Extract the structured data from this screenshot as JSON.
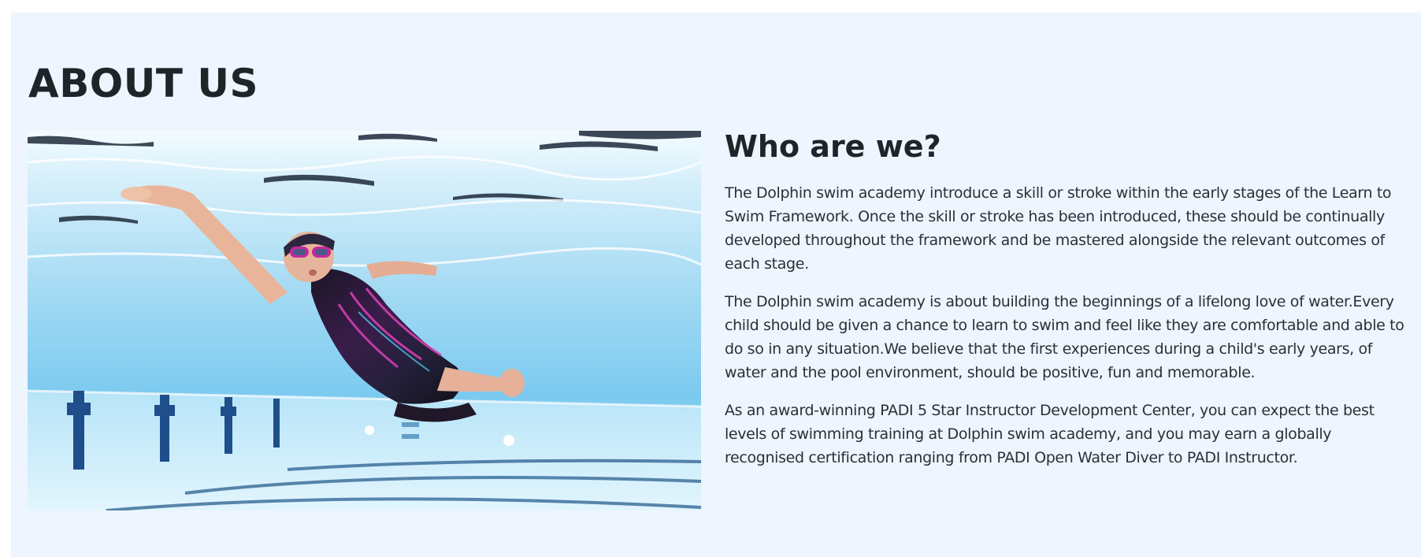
{
  "about": {
    "heading": "ABOUT US",
    "subheading": "Who are we?",
    "paragraphs": [
      "The Dolphin swim academy introduce a skill or stroke within the early stages of the Learn to Swim Framework. Once the skill or stroke has been introduced, these should be continually developed throughout the framework and be mastered alongside the relevant outcomes of each stage.",
      "The Dolphin swim academy is about building the beginnings of a lifelong love of water.Every child should be given a chance to learn to swim and feel like they are comfortable and able to do so in any situation.We believe that the first experiences during a child's early years, of water and the pool environment, should be positive, fun and memorable.",
      "As an award-winning PADI 5 Star Instructor Development Center, you can expect the best levels of swimming training at Dolphin swim academy, and you may earn a globally recognised certification ranging from PADI Open Water Diver to PADI Instructor."
    ]
  },
  "photo": {
    "subject": "underwater-swimmer"
  },
  "colors": {
    "section_bg": "#eef5fe",
    "heading": "#1f2428",
    "body_text": "#2b3035",
    "water_light": "#bfe6f8",
    "water_deep": "#5bbbe8"
  }
}
